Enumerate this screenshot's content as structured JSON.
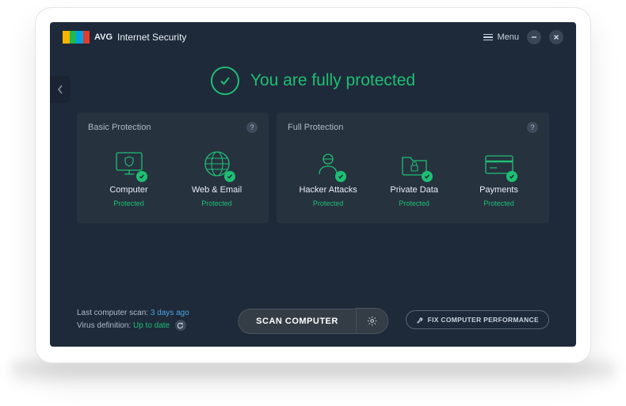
{
  "brand": {
    "name": "AVG",
    "product": "Internet Security"
  },
  "header": {
    "menu_label": "Menu"
  },
  "status": {
    "headline": "You are fully protected"
  },
  "panels": {
    "basic": {
      "title": "Basic Protection",
      "tiles": [
        {
          "name": "Computer",
          "status": "Protected",
          "icon": "monitor-shield-icon"
        },
        {
          "name": "Web & Email",
          "status": "Protected",
          "icon": "globe-icon"
        }
      ]
    },
    "full": {
      "title": "Full Protection",
      "tiles": [
        {
          "name": "Hacker Attacks",
          "status": "Protected",
          "icon": "hacker-icon"
        },
        {
          "name": "Private Data",
          "status": "Protected",
          "icon": "folder-lock-icon"
        },
        {
          "name": "Payments",
          "status": "Protected",
          "icon": "credit-card-icon"
        }
      ]
    }
  },
  "bottom": {
    "last_scan_label": "Last computer scan:",
    "last_scan_value": "3 days ago",
    "virus_def_label": "Virus definition:",
    "virus_def_value": "Up to date",
    "scan_button": "SCAN COMPUTER",
    "fix_button": "FIX COMPUTER PERFORMANCE"
  },
  "colors": {
    "accent": "#1dbf73",
    "link": "#4aa3df"
  }
}
